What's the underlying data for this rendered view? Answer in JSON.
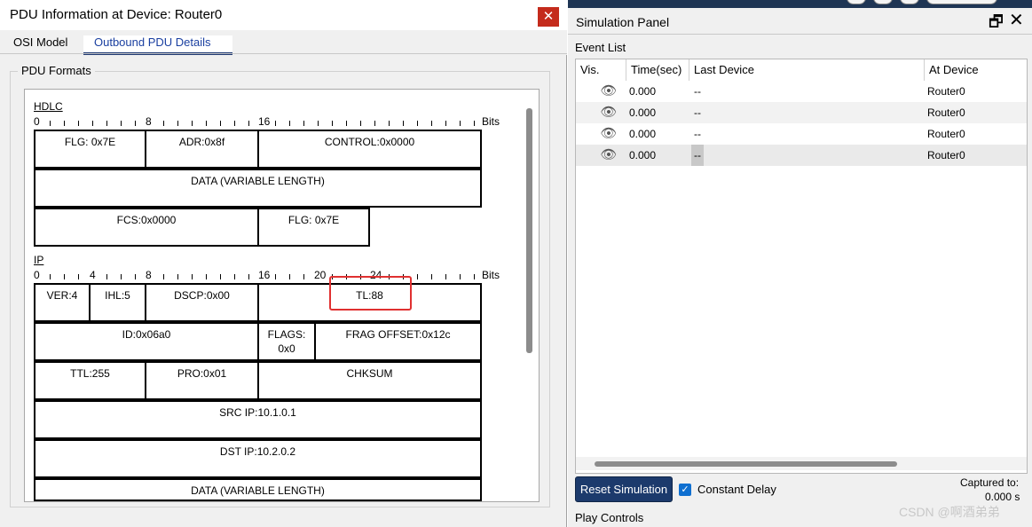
{
  "pdu_window": {
    "title": "PDU Information at Device: Router0",
    "close_glyph": "✕",
    "tabs": [
      {
        "label": "OSI Model",
        "active": false
      },
      {
        "label": "Outbound PDU Details",
        "active": true
      }
    ],
    "group_label": "PDU Formats",
    "bits_label": "Bits",
    "hdlc": {
      "title": "HDLC",
      "ruler": [
        "0",
        "8",
        "16"
      ],
      "fields": [
        "FLG: 0x7E",
        "ADR:0x8f",
        "CONTROL:0x0000",
        "DATA (VARIABLE LENGTH)",
        "FCS:0x0000",
        "FLG: 0x7E"
      ]
    },
    "ip": {
      "title": "IP",
      "ruler": [
        "0",
        "4",
        "8",
        "16",
        "20",
        "24"
      ],
      "fields": [
        "VER:4",
        "IHL:5",
        "DSCP:0x00",
        "TL:88",
        "ID:0x06a0",
        "FLAGS:",
        "0x0",
        "FRAG OFFSET:0x12c",
        "TTL:255",
        "PRO:0x01",
        "CHKSUM",
        "SRC IP:10.1.0.1",
        "DST IP:10.2.0.2",
        "DATA (VARIABLE LENGTH)"
      ]
    }
  },
  "simulation_panel": {
    "title": "Simulation Panel",
    "restore_glyph": "🗗",
    "close_glyph": "✕",
    "event_list_label": "Event List",
    "columns": [
      "Vis.",
      "Time(sec)",
      "Last Device",
      "At Device"
    ],
    "events": [
      {
        "vis": "👁",
        "time": "0.000",
        "last_device": "--",
        "at_device": "Router0"
      },
      {
        "vis": "👁",
        "time": "0.000",
        "last_device": "--",
        "at_device": "Router0"
      },
      {
        "vis": "👁",
        "time": "0.000",
        "last_device": "--",
        "at_device": "Router0"
      },
      {
        "vis": "👁",
        "time": "0.000",
        "last_device": "--",
        "at_device": "Router0"
      }
    ],
    "reset_label": "Reset Simulation",
    "constant_delay_label": "Constant Delay",
    "constant_delay_checked": true,
    "check_glyph": "✓",
    "captured_label": "Captured to:",
    "captured_value": "0.000 s",
    "play_controls_label": "Play Controls"
  },
  "watermark": "CSDN @啊酒弟弟",
  "colors": {
    "accent": "#1c3a6c",
    "highlight": "#e03030",
    "close_red": "#c42b1c",
    "checkbox": "#0f6fd0"
  }
}
